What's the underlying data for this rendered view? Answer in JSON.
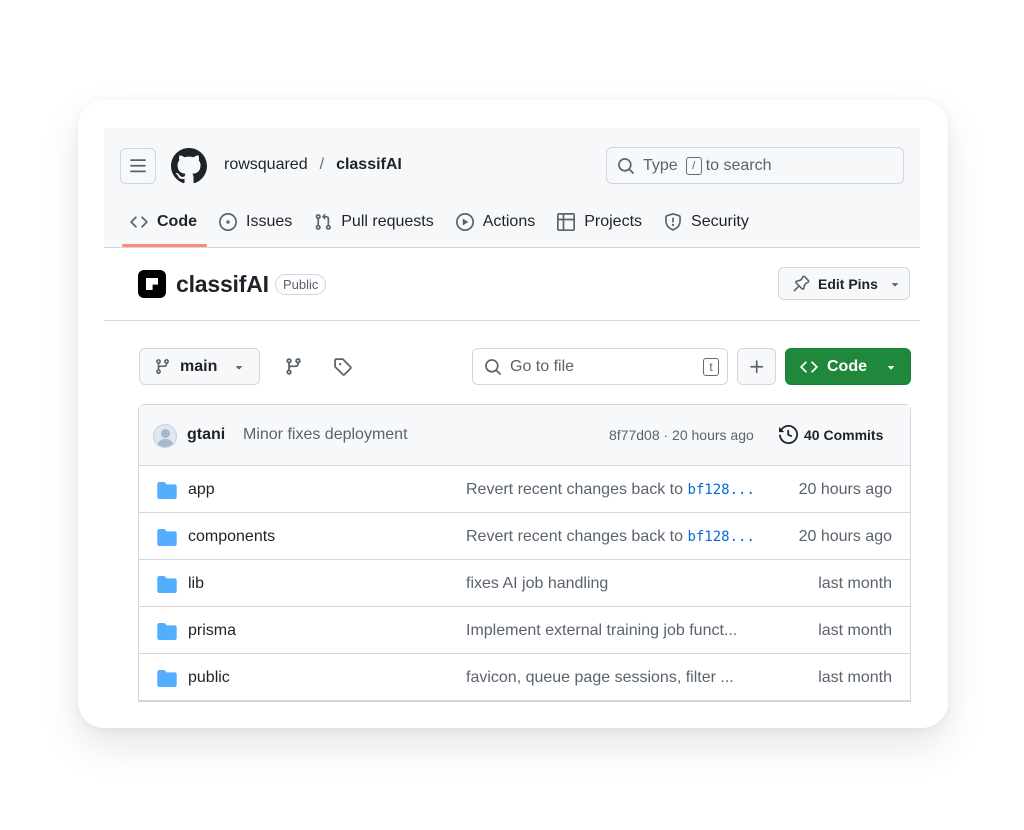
{
  "header": {
    "owner": "rowsquared",
    "separator": "/",
    "repo": "classifAI",
    "search_prefix": "Type",
    "search_key": "/",
    "search_suffix": "to search"
  },
  "tabs": [
    {
      "label": "Code",
      "icon": "code-icon",
      "active": true
    },
    {
      "label": "Issues",
      "icon": "issue-opened-icon"
    },
    {
      "label": "Pull requests",
      "icon": "git-pull-request-icon"
    },
    {
      "label": "Actions",
      "icon": "play-icon"
    },
    {
      "label": "Projects",
      "icon": "table-icon"
    },
    {
      "label": "Security",
      "icon": "shield-icon"
    }
  ],
  "repo": {
    "name": "classifAI",
    "visibility": "Public",
    "edit_pins_label": "Edit Pins"
  },
  "toolbar": {
    "branch": "main",
    "goto_placeholder": "Go to file",
    "goto_key": "t",
    "code_label": "Code"
  },
  "latest_commit": {
    "author": "gtani",
    "message": "Minor fixes deployment",
    "sha_time": "8f77d08 · 20 hours ago",
    "commits_label": "40 Commits"
  },
  "files": [
    {
      "name": "app",
      "msg_text": "Revert recent changes back to ",
      "msg_link": "bf128...",
      "date": "20 hours ago"
    },
    {
      "name": "components",
      "msg_text": "Revert recent changes back to ",
      "msg_link": "bf128...",
      "date": "20 hours ago"
    },
    {
      "name": "lib",
      "msg_text": "fixes AI job handling",
      "msg_link": "",
      "date": "last month"
    },
    {
      "name": "prisma",
      "msg_text": "Implement external training job funct...",
      "msg_link": "",
      "date": "last month"
    },
    {
      "name": "public",
      "msg_text": "favicon, queue page sessions, filter ...",
      "msg_link": "",
      "date": "last month"
    }
  ],
  "colors": {
    "accent_underline": "#fd8c73",
    "primary_button": "#1f883d",
    "folder": "#54aeff",
    "link": "#0969da"
  }
}
